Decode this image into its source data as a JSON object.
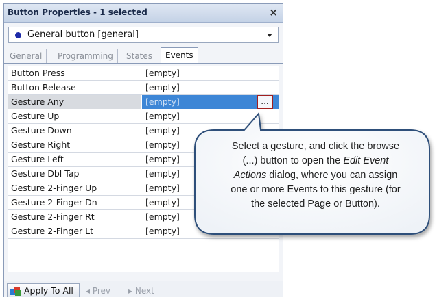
{
  "window": {
    "title": "Button Properties - 1 selected",
    "close_label": "×"
  },
  "selector": {
    "value": "General button  [general]"
  },
  "tabs": [
    {
      "label": "General",
      "active": false
    },
    {
      "label": "Programming",
      "active": false
    },
    {
      "label": "States",
      "active": false
    },
    {
      "label": "Events",
      "active": true
    }
  ],
  "events": [
    {
      "name": "Button Press",
      "value": "[empty]"
    },
    {
      "name": "Button Release",
      "value": "[empty]"
    },
    {
      "name": "Gesture Any",
      "value": "[empty]",
      "selected": true
    },
    {
      "name": "Gesture Up",
      "value": "[empty]"
    },
    {
      "name": "Gesture Down",
      "value": "[empty]"
    },
    {
      "name": "Gesture Right",
      "value": "[empty]"
    },
    {
      "name": "Gesture Left",
      "value": "[empty]"
    },
    {
      "name": "Gesture Dbl Tap",
      "value": "[empty]"
    },
    {
      "name": "Gesture 2-Finger Up",
      "value": "[empty]"
    },
    {
      "name": "Gesture 2-Finger Dn",
      "value": "[empty]"
    },
    {
      "name": "Gesture 2-Finger Rt",
      "value": "[empty]"
    },
    {
      "name": "Gesture 2-Finger Lt",
      "value": "[empty]"
    }
  ],
  "browse_button": {
    "label": "..."
  },
  "bottom": {
    "apply_label": "Apply To All",
    "prev_label": "◂  Prev",
    "next_label": "▸  Next"
  },
  "callout": {
    "line1": "Select a gesture, and click the browse",
    "line2a": "(...) button to open the ",
    "line2b": "Edit Event",
    "line3a": "Actions",
    "line3b": " dialog, where you can assign",
    "line4": "one or more Events to this gesture (for",
    "line5": "the selected Page or Button)."
  },
  "colors": {
    "selection": "#3d86d6",
    "highlight_border": "#a11f1f",
    "callout_border": "#2f4f7a"
  }
}
